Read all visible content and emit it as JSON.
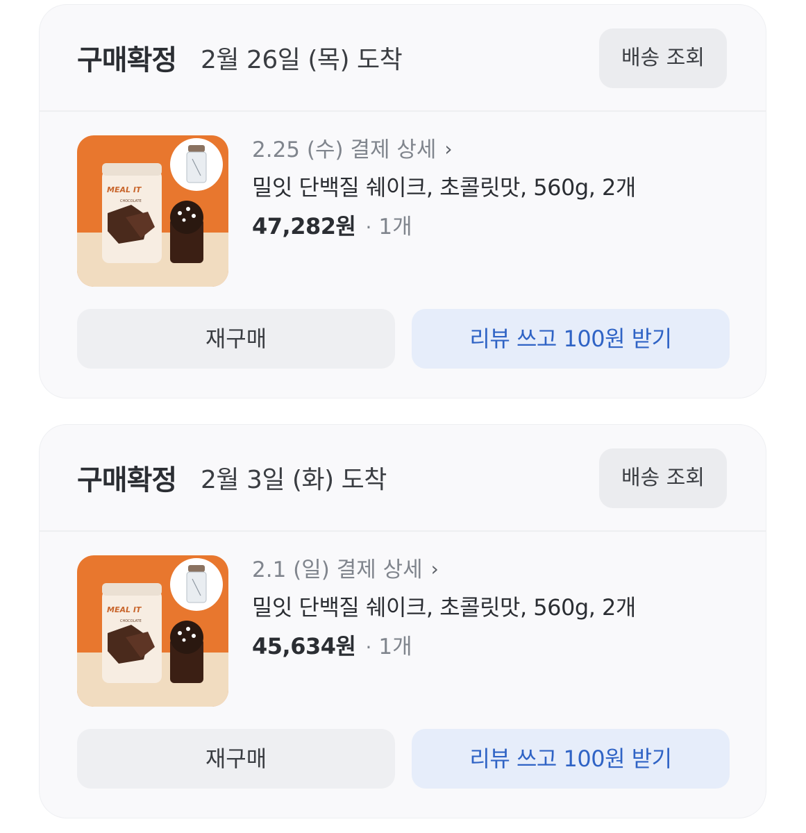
{
  "orders": [
    {
      "status": "구매확정",
      "arrival": "2월 26일 (목) 도착",
      "track_label": "배송 조회",
      "payment_date": "2.25 (수) 결제 상세",
      "product_name": "밀잇 단백질 쉐이크, 초콜릿맛, 560g, 2개",
      "price": "47,282원",
      "separator": "·",
      "quantity": "1개",
      "thumbnail": {
        "brand": "MEAL IT",
        "flavor": "CHOCOLATE"
      },
      "rebuy_label": "재구매",
      "review_label": "리뷰 쓰고 100원 받기"
    },
    {
      "status": "구매확정",
      "arrival": "2월 3일 (화) 도착",
      "track_label": "배송 조회",
      "payment_date": "2.1 (일) 결제 상세",
      "product_name": "밀잇 단백질 쉐이크, 초콜릿맛, 560g, 2개",
      "price": "45,634원",
      "separator": "·",
      "quantity": "1개",
      "thumbnail": {
        "brand": "MEAL IT",
        "flavor": "CHOCOLATE"
      },
      "rebuy_label": "재구매",
      "review_label": "리뷰 쓰고 100원 받기"
    }
  ],
  "icons": {
    "chevron": "chevron-right-icon",
    "chevron_glyph": "›"
  },
  "colors": {
    "card_bg": "#f9f9fb",
    "button_gray": "#eeeff2",
    "review_bg": "#e6edfa",
    "review_text": "#2f63c5",
    "thumb_orange": "#e8772e"
  }
}
